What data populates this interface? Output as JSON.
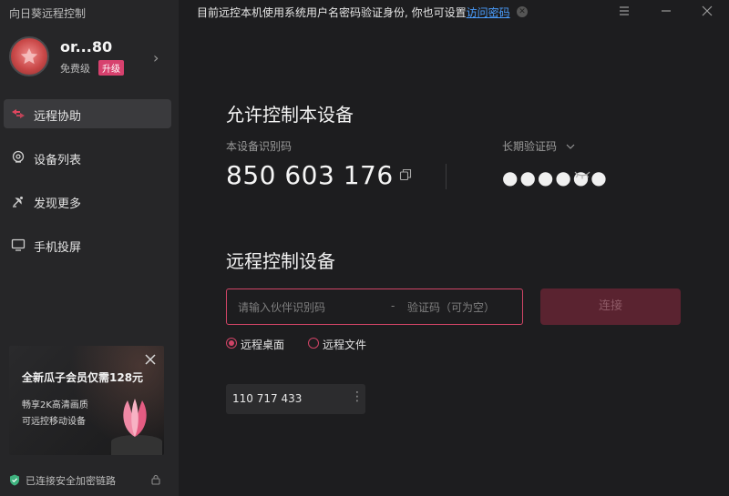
{
  "app": {
    "title": "向日葵远程控制"
  },
  "profile": {
    "username": "or...80",
    "tier": "免费级",
    "upgrade": "升级"
  },
  "nav": [
    {
      "label": "远程协助",
      "icon": "remote-assist-icon",
      "active": true
    },
    {
      "label": "设备列表",
      "icon": "device-list-icon",
      "active": false
    },
    {
      "label": "发现更多",
      "icon": "discover-icon",
      "active": false
    },
    {
      "label": "手机投屏",
      "icon": "screen-cast-icon",
      "active": false
    }
  ],
  "promo": {
    "title": "全新瓜子会员仅需128元",
    "line1": "畅享2K高清画质",
    "line2": "可远控移动设备"
  },
  "secure": {
    "text": "已连接安全加密链路"
  },
  "notice": {
    "text": "目前远控本机使用系统用户名密码验证身份, 你也可设置",
    "link": "访问密码"
  },
  "allow": {
    "heading": "允许控制本设备",
    "id_label": "本设备识别码",
    "device_id": "850 603 176",
    "code_label": "长期验证码",
    "code_masked": "●●●●●●"
  },
  "remote": {
    "heading": "远程控制设备",
    "partner_placeholder": "请输入伙伴识别码",
    "separator": "-",
    "code_placeholder": "验证码（可为空）",
    "connect": "连接",
    "mode_desktop": "远程桌面",
    "mode_file": "远程文件",
    "history_id": "110 717 433"
  },
  "colors": {
    "accent": "#d04466",
    "link": "#4a9eff",
    "sidebar": "#262628",
    "main": "#1d1d1f"
  }
}
